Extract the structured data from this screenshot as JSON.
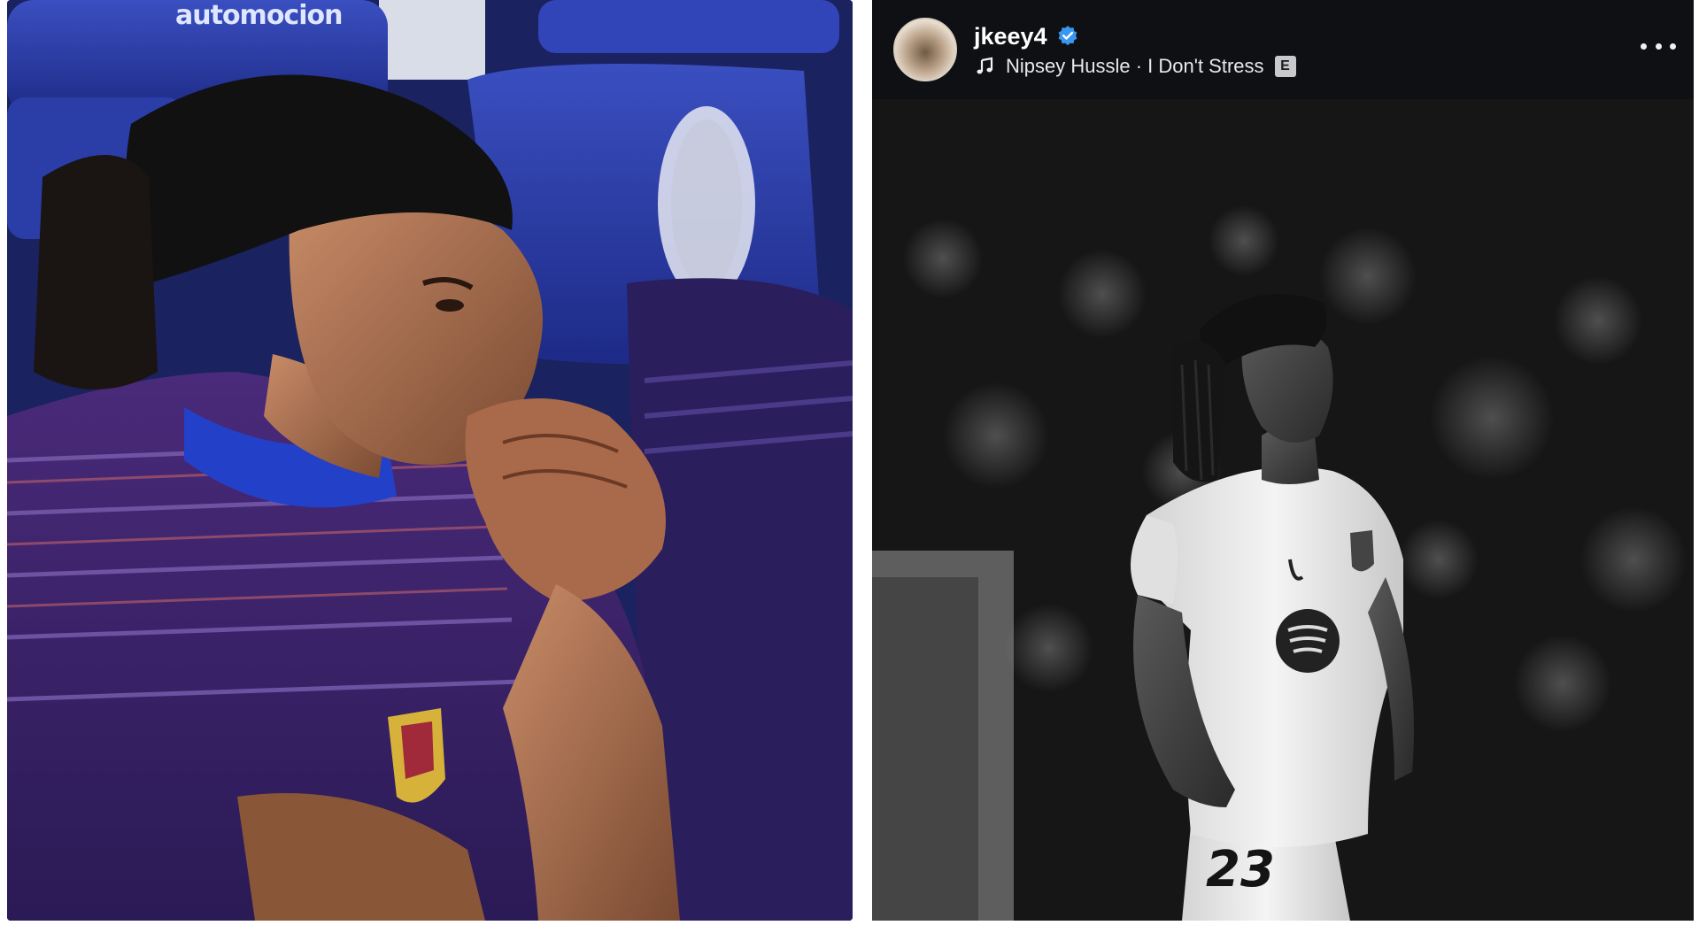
{
  "left_photo": {
    "sponsor_text": "automocion"
  },
  "post": {
    "username": "jkeey4",
    "verified_icon": "verified-badge-icon",
    "music": {
      "icon": "music-note-icon",
      "label": "Nipsey Hussle · I Don't Stress",
      "explicit": "E"
    },
    "more_icon": "more-options-icon",
    "shirt_number": "23"
  },
  "colors": {
    "post_header_bg": "#0f1014",
    "verified_blue": "#3897f0",
    "bench_blue": "#23307a"
  }
}
